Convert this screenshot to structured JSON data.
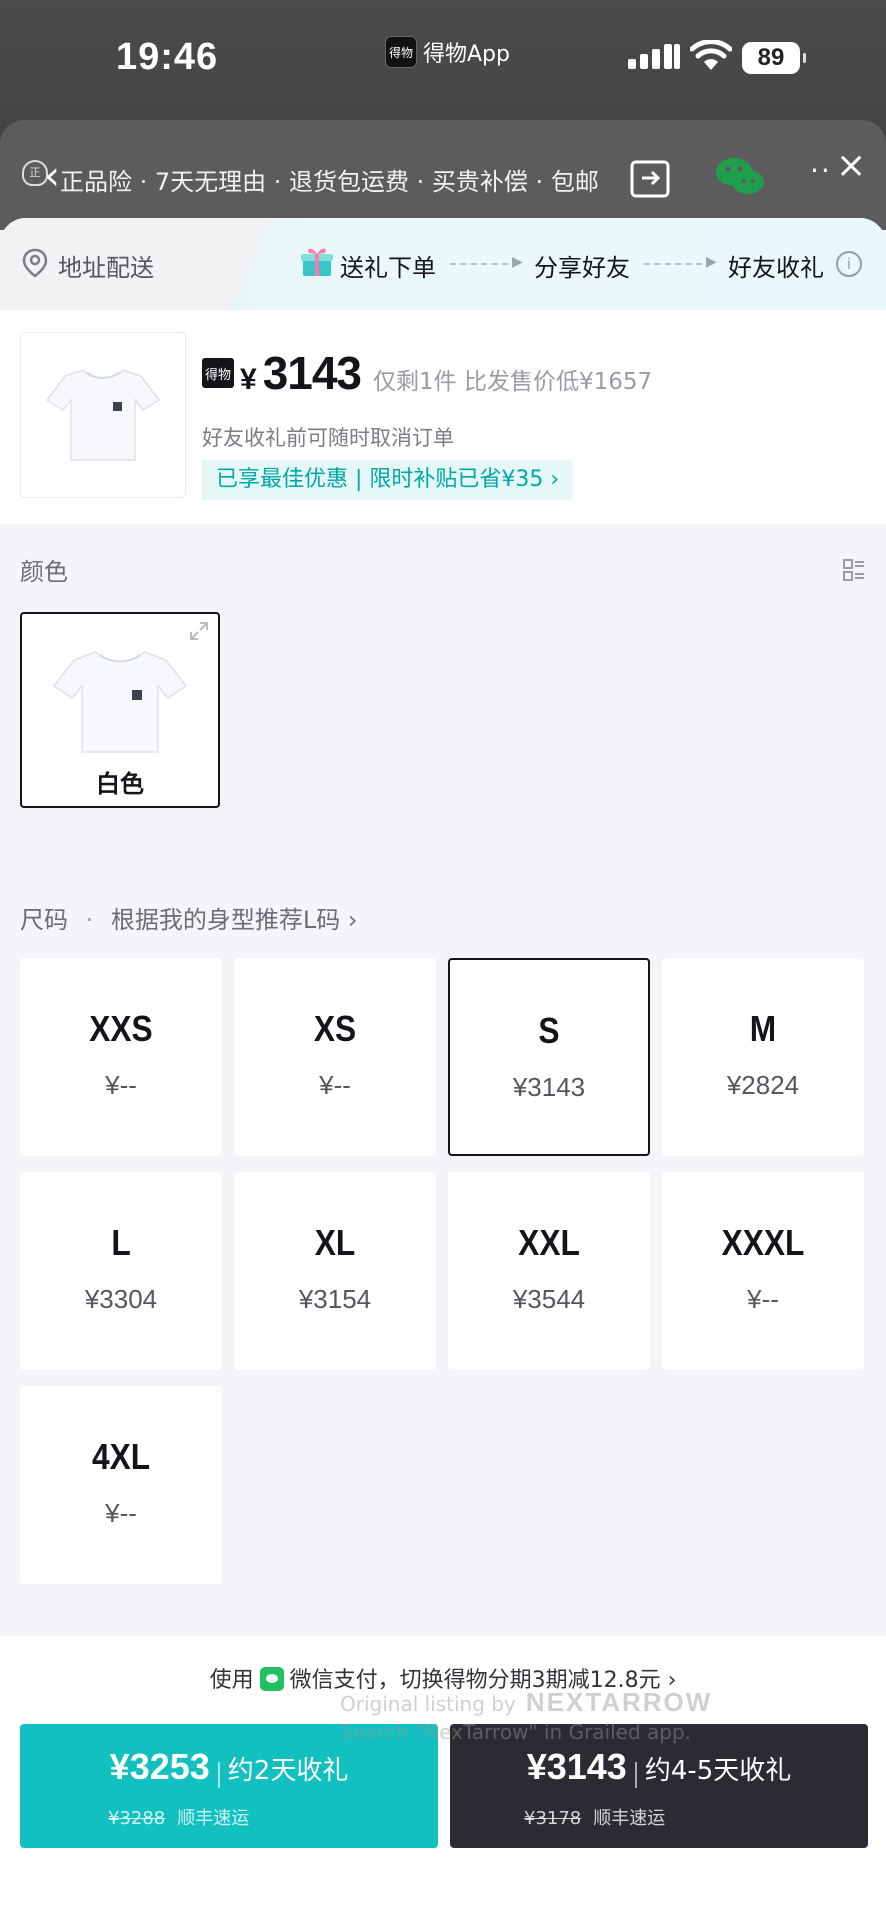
{
  "status_bar": {
    "time": "19:46",
    "app_name": "得物App",
    "app_logo_text": "得物",
    "battery": "89"
  },
  "guarantee": {
    "items": "正品险 · 7天无理由 · 退货包运费 · 买贵补偿 · 包邮",
    "badge": "正"
  },
  "steps": {
    "address": "地址配送",
    "step1": "送礼下单",
    "step2": "分享好友",
    "step3": "好友收礼",
    "info_glyph": "i"
  },
  "product": {
    "brand_badge": "得物",
    "currency": "¥",
    "price": "3143",
    "stock_note": "仅剩1件 比发售价低¥1657",
    "cancel_note": "好友收礼前可随时取消订单",
    "promo": "已享最佳优惠 | 限时补贴已省¥35 ›"
  },
  "color_section": {
    "label": "颜色",
    "options": [
      {
        "name": "白色",
        "selected": true
      }
    ]
  },
  "size_section": {
    "label": "尺码",
    "dot": "·",
    "hint": "根据我的身型推荐L码 ›",
    "sizes": [
      {
        "name": "XXS",
        "price": "¥--"
      },
      {
        "name": "XS",
        "price": "¥--"
      },
      {
        "name": "S",
        "price": "¥3143",
        "selected": true
      },
      {
        "name": "M",
        "price": "¥2824"
      },
      {
        "name": "L",
        "price": "¥3304"
      },
      {
        "name": "XL",
        "price": "¥3154"
      },
      {
        "name": "XXL",
        "price": "¥3544"
      },
      {
        "name": "XXXL",
        "price": "¥--"
      },
      {
        "name": "4XL",
        "price": "¥--"
      }
    ]
  },
  "payment": {
    "prefix": "使用",
    "text": "微信支付，切换得物分期3期减12.8元 ›"
  },
  "buttons": {
    "fast": {
      "price": "¥3253",
      "eta": "约2天收礼",
      "original": "¥3288",
      "shipping": "顺丰速运"
    },
    "normal": {
      "price": "¥3143",
      "eta": "约4-5天收礼",
      "original": "¥3178",
      "shipping": "顺丰速运"
    }
  },
  "watermark": {
    "line1": "Original listing by",
    "brand": "NEXTARROW",
    "line2": "Search \"NexTarrow\" in Grailed app."
  },
  "colors": {
    "teal": "#12c0c0",
    "dark": "#2b2b33",
    "promo_text": "#01a8a8",
    "wechat_green": "#21c15f"
  }
}
